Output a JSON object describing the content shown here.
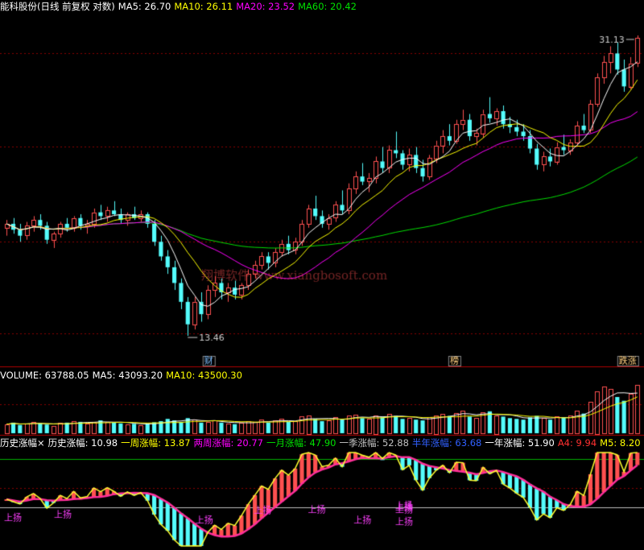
{
  "header_main": {
    "title": "能科股份(日线 前复权 对数)",
    "ma5": "MA5: 26.70",
    "ma10": "MA10: 26.11",
    "ma20": "MA20: 23.52",
    "ma60": "MA60: 20.42"
  },
  "header_volume": {
    "label": "VOLUME: 63788.05",
    "ma5": "MA5: 43093.20",
    "ma10": "MA10: 43500.30"
  },
  "header_indicator": {
    "name": "历史涨幅×",
    "hist": "历史涨幅: 10.98",
    "week1": "一周涨幅: 13.87",
    "week2": "两周涨幅: 20.77",
    "month1": "一月涨幅: 47.90",
    "season": "一季涨幅: 52.88",
    "half": "半年涨幅: 63.68",
    "year": "一年涨幅: 51.90",
    "a4": "A4: 9.94",
    "m5": "M5: 8.20"
  },
  "watermark": "翔博软件 www.xiangbosoft.com",
  "colors": {
    "up": "#ff5050",
    "down": "#54fcfc",
    "ma5": "#ffffff",
    "ma10": "#ffff00",
    "ma20": "#ff00ff",
    "ma60": "#00e000",
    "grid": "#8a0000",
    "indicator_main": "#ffff30",
    "indicator_ma": "#ff2f9a",
    "shang_yang": "#ff40ff"
  },
  "chart_data": {
    "type": "candlestick",
    "price_scale": "log",
    "price_range": [
      12.5,
      33
    ],
    "annotations": {
      "high_label": "31.13",
      "high_value": 31.13,
      "low_label": "13.46",
      "low_value": 13.46,
      "markers": [
        "财",
        "榜",
        "跌涨"
      ],
      "indicator_markers": [
        "上扬",
        "上扬",
        "上扬",
        "上扬",
        "上扬",
        "上扬",
        "上扬",
        "上扬",
        "上扬",
        "上扬"
      ]
    },
    "candles": [
      [
        18.2,
        18.6,
        17.8,
        18.4
      ],
      [
        18.4,
        18.7,
        17.9,
        18.1
      ],
      [
        18.1,
        18.4,
        17.5,
        17.8
      ],
      [
        17.8,
        18.5,
        17.6,
        18.3
      ],
      [
        18.3,
        18.8,
        18.0,
        18.6
      ],
      [
        18.6,
        18.9,
        18.1,
        18.3
      ],
      [
        18.3,
        18.5,
        17.4,
        17.6
      ],
      [
        17.6,
        18.0,
        17.2,
        17.9
      ],
      [
        17.9,
        18.5,
        17.7,
        18.4
      ],
      [
        18.4,
        18.7,
        18.0,
        18.2
      ],
      [
        18.2,
        18.8,
        18.0,
        18.7
      ],
      [
        18.7,
        18.9,
        18.1,
        18.3
      ],
      [
        18.3,
        18.6,
        17.9,
        18.4
      ],
      [
        18.4,
        19.2,
        18.2,
        19.0
      ],
      [
        19.0,
        19.4,
        18.6,
        18.8
      ],
      [
        18.8,
        19.3,
        18.5,
        19.1
      ],
      [
        19.1,
        19.6,
        18.8,
        18.9
      ],
      [
        18.9,
        19.2,
        18.4,
        18.6
      ],
      [
        18.6,
        19.0,
        18.3,
        18.9
      ],
      [
        18.9,
        19.3,
        18.6,
        18.7
      ],
      [
        18.7,
        19.1,
        18.5,
        18.9
      ],
      [
        18.9,
        19.0,
        18.2,
        18.4
      ],
      [
        18.4,
        18.6,
        17.3,
        17.5
      ],
      [
        17.5,
        17.8,
        16.6,
        16.8
      ],
      [
        16.8,
        17.1,
        16.0,
        16.3
      ],
      [
        16.3,
        16.6,
        15.3,
        15.6
      ],
      [
        15.6,
        15.8,
        14.5,
        14.8
      ],
      [
        14.8,
        15.0,
        13.46,
        13.9
      ],
      [
        13.9,
        15.0,
        13.7,
        14.8
      ],
      [
        14.8,
        15.2,
        14.0,
        14.3
      ],
      [
        14.3,
        15.5,
        14.1,
        15.3
      ],
      [
        15.3,
        15.9,
        15.0,
        15.6
      ],
      [
        15.6,
        15.8,
        14.9,
        15.2
      ],
      [
        15.2,
        15.6,
        14.8,
        15.4
      ],
      [
        15.4,
        15.7,
        14.9,
        15.1
      ],
      [
        15.1,
        15.6,
        14.9,
        15.5
      ],
      [
        15.5,
        16.2,
        15.3,
        16.0
      ],
      [
        16.0,
        16.6,
        15.8,
        16.4
      ],
      [
        16.4,
        17.0,
        16.2,
        16.8
      ],
      [
        16.8,
        17.0,
        16.2,
        16.5
      ],
      [
        16.5,
        17.2,
        16.3,
        17.0
      ],
      [
        17.0,
        17.6,
        16.8,
        17.4
      ],
      [
        17.4,
        17.8,
        16.9,
        17.1
      ],
      [
        17.1,
        17.7,
        16.9,
        17.5
      ],
      [
        17.5,
        18.6,
        17.3,
        18.4
      ],
      [
        18.4,
        19.4,
        18.2,
        19.2
      ],
      [
        19.2,
        19.9,
        18.6,
        18.8
      ],
      [
        18.8,
        19.1,
        18.2,
        18.4
      ],
      [
        18.4,
        18.9,
        18.1,
        18.7
      ],
      [
        18.7,
        19.6,
        18.5,
        19.4
      ],
      [
        19.4,
        20.2,
        18.9,
        19.1
      ],
      [
        19.1,
        20.6,
        18.9,
        20.3
      ],
      [
        20.3,
        21.3,
        20.0,
        21.0
      ],
      [
        21.0,
        21.8,
        20.5,
        20.7
      ],
      [
        20.7,
        21.2,
        20.1,
        20.9
      ],
      [
        20.9,
        22.2,
        20.6,
        21.9
      ],
      [
        21.9,
        22.8,
        21.2,
        21.5
      ],
      [
        21.5,
        22.9,
        21.2,
        22.6
      ],
      [
        22.6,
        23.8,
        22.1,
        22.4
      ],
      [
        22.4,
        22.6,
        21.4,
        21.7
      ],
      [
        21.7,
        22.7,
        21.3,
        22.3
      ],
      [
        22.3,
        22.8,
        21.2,
        21.5
      ],
      [
        21.5,
        22.0,
        20.7,
        21.0
      ],
      [
        21.0,
        22.3,
        20.8,
        22.1
      ],
      [
        22.1,
        23.2,
        21.8,
        22.9
      ],
      [
        22.9,
        23.9,
        22.4,
        23.5
      ],
      [
        23.5,
        24.3,
        22.9,
        23.2
      ],
      [
        23.2,
        24.6,
        23.0,
        24.3
      ],
      [
        24.3,
        25.3,
        23.9,
        24.6
      ],
      [
        24.6,
        25.0,
        23.2,
        23.5
      ],
      [
        23.5,
        24.0,
        22.9,
        23.7
      ],
      [
        23.7,
        25.3,
        23.4,
        25.0
      ],
      [
        25.0,
        26.2,
        24.4,
        24.7
      ],
      [
        24.7,
        25.4,
        24.2,
        25.2
      ],
      [
        25.2,
        25.6,
        24.0,
        24.3
      ],
      [
        24.3,
        24.8,
        23.7,
        24.1
      ],
      [
        24.1,
        24.6,
        23.5,
        23.8
      ],
      [
        23.8,
        24.3,
        23.2,
        23.5
      ],
      [
        23.5,
        23.9,
        22.4,
        22.7
      ],
      [
        22.7,
        23.0,
        21.4,
        21.7
      ],
      [
        21.7,
        22.5,
        21.3,
        22.2
      ],
      [
        22.2,
        22.7,
        21.6,
        21.9
      ],
      [
        21.9,
        23.1,
        21.7,
        22.8
      ],
      [
        22.8,
        23.6,
        22.3,
        22.6
      ],
      [
        22.6,
        23.3,
        22.3,
        23.1
      ],
      [
        23.1,
        24.5,
        22.9,
        24.2
      ],
      [
        24.2,
        25.0,
        23.7,
        23.9
      ],
      [
        23.9,
        26.0,
        23.7,
        25.7
      ],
      [
        25.7,
        28.0,
        25.5,
        27.7
      ],
      [
        27.7,
        29.4,
        27.2,
        28.9
      ],
      [
        28.9,
        30.2,
        28.0,
        29.6
      ],
      [
        29.6,
        30.5,
        27.9,
        28.3
      ],
      [
        28.3,
        29.1,
        26.6,
        27.0
      ],
      [
        27.0,
        29.3,
        26.8,
        28.8
      ],
      [
        28.8,
        31.13,
        28.5,
        30.9
      ]
    ],
    "volumes": [
      120,
      140,
      110,
      125,
      150,
      130,
      115,
      100,
      135,
      140,
      160,
      150,
      130,
      145,
      170,
      150,
      140,
      130,
      120,
      125,
      110,
      130,
      145,
      160,
      190,
      170,
      150,
      200,
      180,
      140,
      150,
      170,
      140,
      130,
      120,
      140,
      160,
      150,
      180,
      140,
      170,
      190,
      150,
      160,
      220,
      240,
      190,
      160,
      170,
      210,
      180,
      230,
      250,
      200,
      190,
      240,
      210,
      260,
      230,
      190,
      200,
      180,
      170,
      210,
      240,
      260,
      230,
      270,
      300,
      220,
      200,
      280,
      290,
      240,
      220,
      200,
      190,
      180,
      210,
      230,
      200,
      180,
      220,
      210,
      230,
      300,
      260,
      420,
      560,
      620,
      590,
      480,
      430,
      520,
      640
    ],
    "indicator": {
      "reference_lines": [
        55,
        25
      ],
      "ranges": [
        0,
        60
      ]
    }
  }
}
